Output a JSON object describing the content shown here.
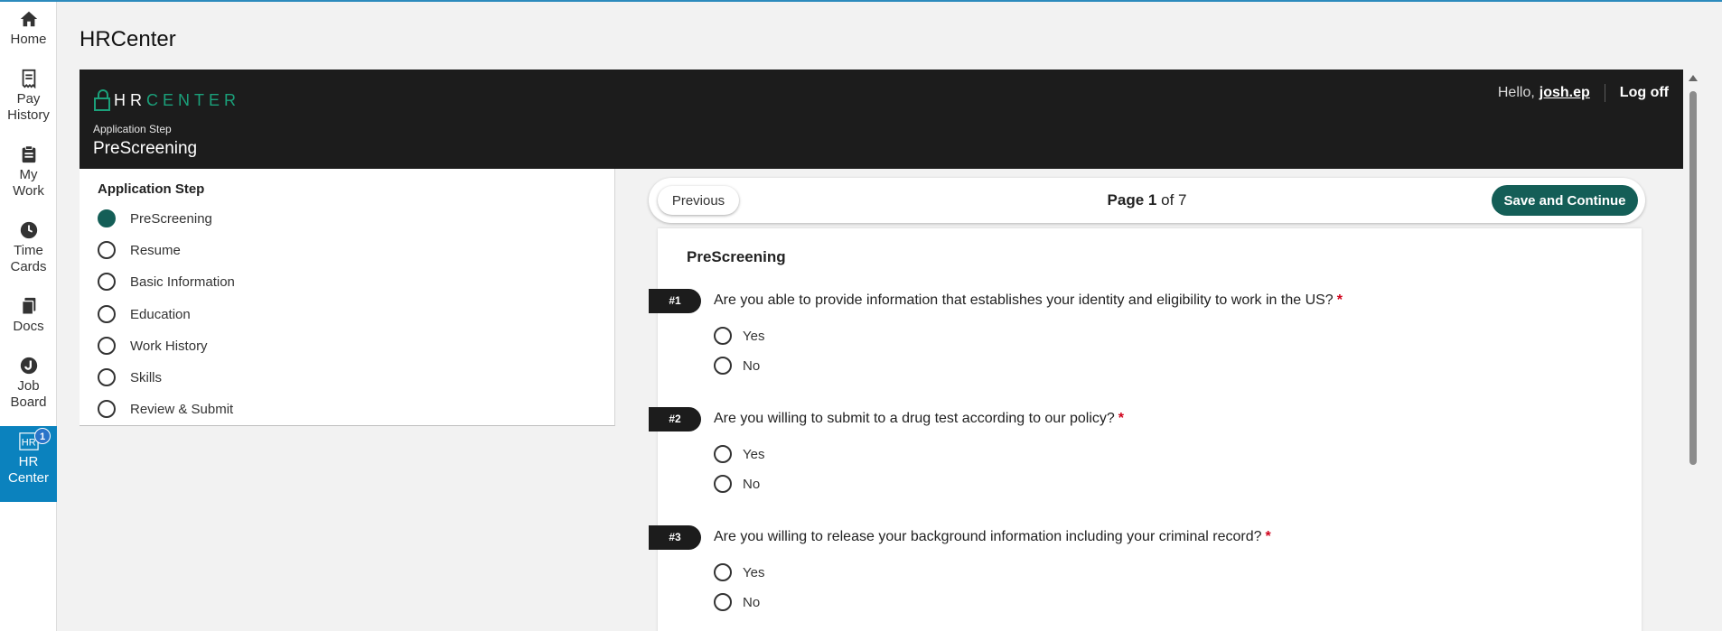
{
  "rail": {
    "items": [
      {
        "label": "Home",
        "icon": "home-icon"
      },
      {
        "label": "Pay History",
        "icon": "receipt-icon"
      },
      {
        "label": "My Work",
        "icon": "clipboard-icon"
      },
      {
        "label": "Time Cards",
        "icon": "clock-icon"
      },
      {
        "label": "Docs",
        "icon": "documents-icon"
      },
      {
        "label": "Job Board",
        "icon": "job-board-icon"
      },
      {
        "label": "HR Center",
        "icon": "hr-icon",
        "badge": "1",
        "active": true
      }
    ]
  },
  "page": {
    "title": "HRCenter"
  },
  "header": {
    "logo_hr": "HR",
    "logo_center": "CENTER",
    "step_label": "Application Step",
    "step_title": "PreScreening",
    "hello": "Hello,",
    "username": "josh.ep",
    "logoff": "Log off"
  },
  "steps": {
    "title": "Application Step",
    "items": [
      {
        "label": "PreScreening",
        "current": true
      },
      {
        "label": "Resume"
      },
      {
        "label": "Basic Information"
      },
      {
        "label": "Education"
      },
      {
        "label": "Work History"
      },
      {
        "label": "Skills"
      },
      {
        "label": "Review & Submit"
      }
    ]
  },
  "pager": {
    "previous": "Previous",
    "page_word": "Page",
    "current": "1",
    "of_total": "of 7",
    "save": "Save and Continue"
  },
  "form": {
    "title": "PreScreening",
    "questions": [
      {
        "tag": "#1",
        "text": "Are you able to provide information that establishes your identity and eligibility to work in the US?",
        "required": "*",
        "options": [
          "Yes",
          "No"
        ]
      },
      {
        "tag": "#2",
        "text": "Are you willing to submit to a drug test according to our policy?",
        "required": "*",
        "options": [
          "Yes",
          "No"
        ]
      },
      {
        "tag": "#3",
        "text": "Are you willing to release your background information including your criminal record?",
        "required": "*",
        "options": [
          "Yes",
          "No"
        ]
      }
    ]
  },
  "colors": {
    "accent": "#145e57",
    "rail_active": "#0b82be",
    "header_bg": "#1c1c1c",
    "logo_green": "#1ba07a",
    "required": "#d0021b"
  }
}
